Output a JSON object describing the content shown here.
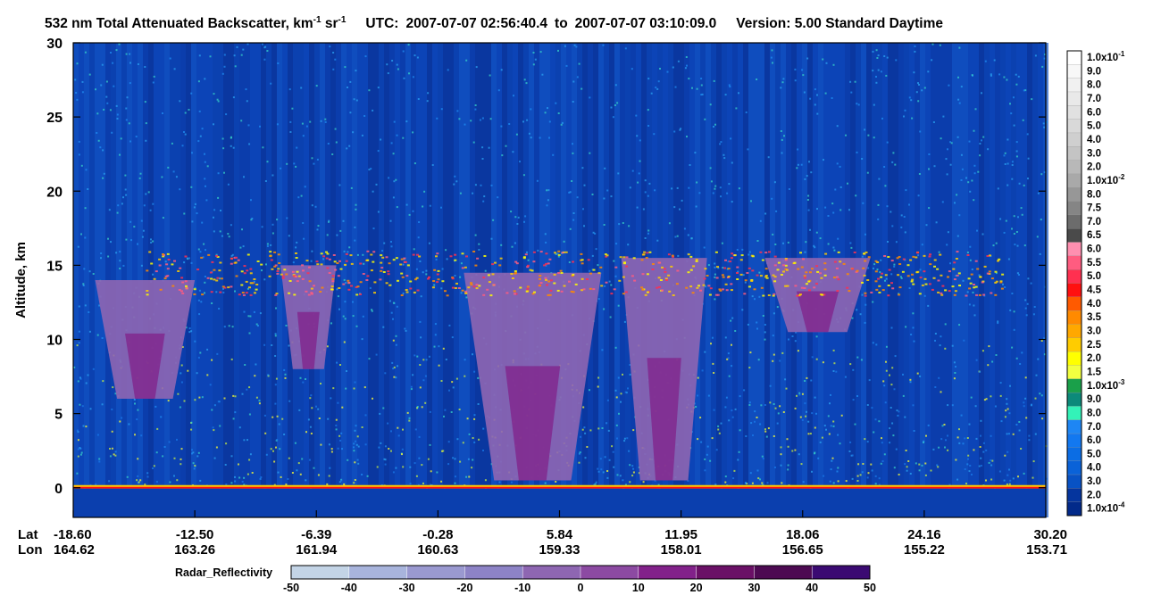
{
  "chart_data": {
    "type": "heatmap",
    "title": {
      "measurement": "532 nm Total Attenuated Backscatter, km",
      "km_exp": "-1",
      "sr": " sr",
      "sr_exp": "-1",
      "utc_label": "UTC:",
      "utc_start": "2007-07-07 02:56:40.4",
      "utc_to": "to",
      "utc_end": "2007-07-07 03:10:09.0",
      "version": "Version: 5.00  Standard  Daytime"
    },
    "ylabel": "Altitude, km",
    "ylim": [
      -2,
      30
    ],
    "y_ticks": [
      "30",
      "25",
      "20",
      "15",
      "10",
      "5",
      "0"
    ],
    "y_tick_values": [
      30,
      25,
      20,
      15,
      10,
      5,
      0
    ],
    "x_axis": {
      "lat_label": "Lat",
      "lon_label": "Lon",
      "lat_ticks": [
        "-18.60",
        "-12.50",
        "-6.39",
        "-0.28",
        "5.84",
        "11.95",
        "18.06",
        "24.16",
        "30.20"
      ],
      "lon_ticks": [
        "164.62",
        "163.26",
        "161.94",
        "160.63",
        "159.33",
        "158.01",
        "156.65",
        "155.22",
        "153.71"
      ]
    },
    "features": {
      "surface_altitude_km": 0,
      "cirrus_layer_km": [
        13,
        16
      ],
      "radar_clouds": [
        {
          "lat_range": [
            -17.5,
            -12.5
          ],
          "alt_range_km": [
            6,
            14
          ]
        },
        {
          "lat_range": [
            -8.2,
            -5.4
          ],
          "alt_range_km": [
            8,
            15
          ]
        },
        {
          "lat_range": [
            1.0,
            7.9
          ],
          "alt_range_km": [
            0.5,
            14.5
          ]
        },
        {
          "lat_range": [
            8.9,
            13.2
          ],
          "alt_range_km": [
            0.5,
            15.5
          ]
        },
        {
          "lat_range": [
            16.1,
            21.4
          ],
          "alt_range_km": [
            10.5,
            15.5
          ]
        }
      ]
    },
    "colorbar": {
      "labels": [
        "1.0x10",
        "9.0",
        "8.0",
        "7.0",
        "6.0",
        "5.0",
        "4.0",
        "3.0",
        "2.0",
        "1.0x10",
        "8.0",
        "7.5",
        "7.0",
        "6.5",
        "6.0",
        "5.5",
        "5.0",
        "4.5",
        "4.0",
        "3.5",
        "3.0",
        "2.5",
        "2.0",
        "1.5",
        "1.0x10",
        "9.0",
        "8.0",
        "7.0",
        "6.0",
        "5.0",
        "4.0",
        "3.0",
        "2.0",
        "1.0x10"
      ],
      "exponents": [
        "-1",
        "",
        "",
        "",
        "",
        "",
        "",
        "",
        "",
        "-2",
        "",
        "",
        "",
        "",
        "",
        "",
        "",
        "",
        "",
        "",
        "",
        "",
        "",
        "",
        "-3",
        "",
        "",
        "",
        "",
        "",
        "",
        "",
        "",
        "-4"
      ],
      "colors": [
        "#ffffff",
        "#f8f8f8",
        "#f1f1f1",
        "#e9e9e9",
        "#e1e1e1",
        "#d9d9d9",
        "#cfcfcf",
        "#c4c4c4",
        "#b8b8b8",
        "#a9a9a9",
        "#979797",
        "#858585",
        "#6c6c6c",
        "#4a4a4a",
        "#ff8fb0",
        "#ff5c80",
        "#ff3050",
        "#ff1010",
        "#ff5a00",
        "#ff8a00",
        "#ffa800",
        "#ffcc00",
        "#ffff00",
        "#f2ff40",
        "#1aa04a",
        "#0c8a7a",
        "#33f2b8",
        "#1e86f4",
        "#1278f0",
        "#0b6de4",
        "#0a62d8",
        "#0852c4",
        "#05359e",
        "#022a8a"
      ]
    },
    "radar_colorbar": {
      "label": "Radar_Reflectivity",
      "ticks": [
        "-50",
        "-40",
        "-30",
        "-20",
        "-10",
        "0",
        "10",
        "20",
        "30",
        "40",
        "50"
      ],
      "colors": [
        "#c3d4e6",
        "#a8b4dc",
        "#9a99d0",
        "#8d83c6",
        "#8e66b2",
        "#8c4aa2",
        "#82218a",
        "#6a1066",
        "#4d0a52",
        "#3b0a72"
      ]
    }
  }
}
